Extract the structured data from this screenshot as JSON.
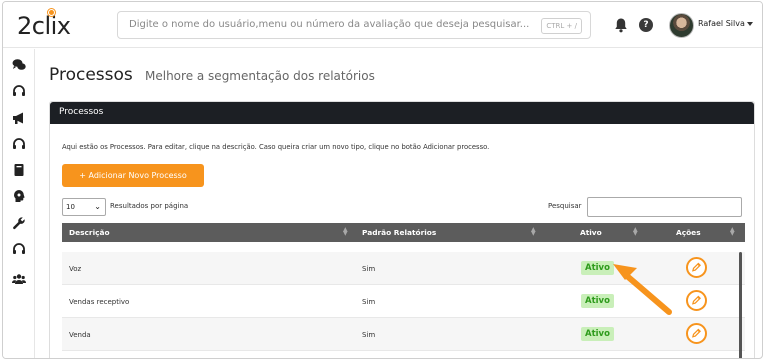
{
  "header": {
    "logo": "2clix",
    "search_placeholder": "Digite o nome do usuário,menu ou número da avaliação que deseja pesquisar...",
    "search_shortcut": "CTRL + /",
    "help_label": "?",
    "user_name": "Rafael Silva"
  },
  "page": {
    "title": "Processos",
    "subtitle": "Melhore a segmentação dos relatórios"
  },
  "panel": {
    "heading": "Processos",
    "info_text": "Aqui estão os Processos. Para editar, clique na descrição. Caso queira criar um novo tipo, clique no botão Adicionar processo.",
    "add_button": "+ Adicionar Novo Processo",
    "page_size": "10",
    "page_size_label": "Resultados por página",
    "search_label": "Pesquisar",
    "search_value": ""
  },
  "table": {
    "columns": [
      "Descrição",
      "Padrão Relatórios",
      "Ativo",
      "Ações"
    ],
    "rows": [
      {
        "descricao": "Voz",
        "padrao": "Sim",
        "ativo": "Ativo"
      },
      {
        "descricao": "Vendas receptivo",
        "padrao": "Sim",
        "ativo": "Ativo"
      },
      {
        "descricao": "Venda",
        "padrao": "Sim",
        "ativo": "Ativo"
      }
    ]
  },
  "sidebar": {
    "icons": [
      "chat-icon",
      "headset-icon",
      "megaphone-icon",
      "headset-icon",
      "book-icon",
      "brain-icon",
      "wrench-icon",
      "headset-icon",
      "users-icon"
    ]
  },
  "colors": {
    "accent": "#f7941d",
    "header_dark": "#1c1f24",
    "table_head": "#5c5c5c",
    "badge_bg": "#c9efb9",
    "badge_text": "#2e9b1c"
  }
}
